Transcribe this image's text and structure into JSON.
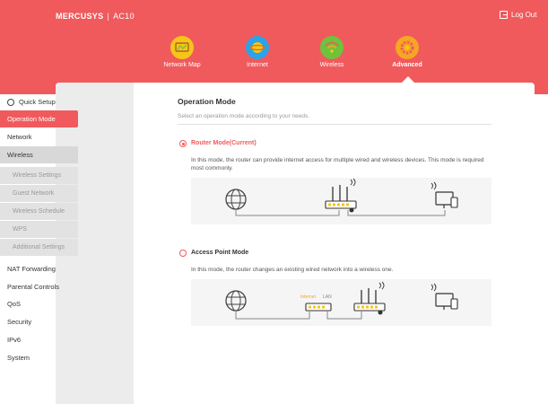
{
  "header": {
    "brand": "MERCUSYS",
    "separator": "|",
    "model": "AC10",
    "logout_label": "Log Out"
  },
  "top_nav": [
    {
      "label": "Network Map",
      "icon": "network-map-icon",
      "color": "#f5c518"
    },
    {
      "label": "Internet",
      "icon": "internet-globe-icon",
      "color": "#2aa3e8"
    },
    {
      "label": "Wireless",
      "icon": "wireless-icon",
      "color": "#6fc23c"
    },
    {
      "label": "Advanced",
      "icon": "advanced-gear-icon",
      "color": "#f5a623"
    }
  ],
  "sidebar": {
    "quick_setup": "Quick Setup",
    "items": [
      "Operation Mode",
      "Network",
      "Wireless",
      "NAT Forwarding",
      "Parental Controls",
      "QoS",
      "Security",
      "IPv6",
      "System"
    ],
    "wireless_sub": [
      "Wireless Settings",
      "Guest Network",
      "Wireless Schedule",
      "WPS",
      "Additional Settings"
    ]
  },
  "main": {
    "title": "Operation Mode",
    "subtitle": "Select an operation mode according to your needs.",
    "router_mode": {
      "label": "Router Mode(Current)",
      "desc": "In this mode, the router can provide internet access for multiple wired and wireless devices. This mode is required most commonly."
    },
    "ap_mode": {
      "label": "Access Point Mode",
      "desc": "In this mode, the router changes an existing wired network into a wireless one.",
      "internet_tag": "Internet",
      "lan_tag": "LAN"
    }
  },
  "colors": {
    "accent": "#f05a5c",
    "tag_orange": "#f5a623"
  }
}
